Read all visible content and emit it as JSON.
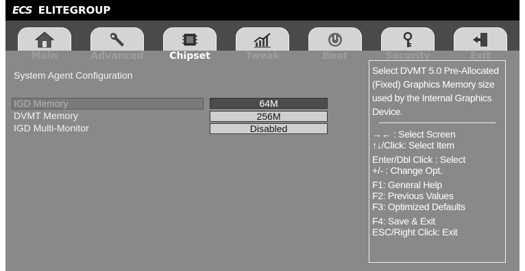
{
  "brand": {
    "logo": "ECS",
    "name": "ELITEGROUP"
  },
  "tabs": [
    {
      "label": "Main",
      "icon": "home-icon",
      "active": false
    },
    {
      "label": "Advanced",
      "icon": "wrench-icon",
      "active": false
    },
    {
      "label": "Chipset",
      "icon": "chip-icon",
      "active": true
    },
    {
      "label": "Tweak",
      "icon": "performance-chart-icon",
      "active": false
    },
    {
      "label": "Boot",
      "icon": "power-icon",
      "active": false
    },
    {
      "label": "Security",
      "icon": "key-icon",
      "active": false
    },
    {
      "label": "Exit",
      "icon": "exit-door-icon",
      "active": false
    }
  ],
  "section_title": "System Agent Configuration",
  "settings": [
    {
      "label": "IGD Memory",
      "value": "64M",
      "selected": true
    },
    {
      "label": "DVMT Memory",
      "value": "256M",
      "selected": false
    },
    {
      "label": "IGD Multi-Monitor",
      "value": "Disabled",
      "selected": false
    }
  ],
  "help": {
    "description": "Select DVMT 5.0 Pre-Allocated (Fixed) Graphics Memory size used by the Internal Graphics Device.",
    "keys": [
      "→← : Select Screen",
      "↑↓/Click: Select Item",
      "Enter/Dbl Click : Select",
      "+/- : Change Opt.",
      "F1: General Help",
      "F2: Previous Values",
      "F3: Optimized Defaults",
      "F4: Save & Exit",
      "ESC/Right Click: Exit"
    ]
  },
  "colors": {
    "background": "#898989",
    "header": "#000000",
    "tabbar": "#4a4a4a",
    "tab": "#d4d4d4",
    "selected_value": "#4c4c4c"
  }
}
